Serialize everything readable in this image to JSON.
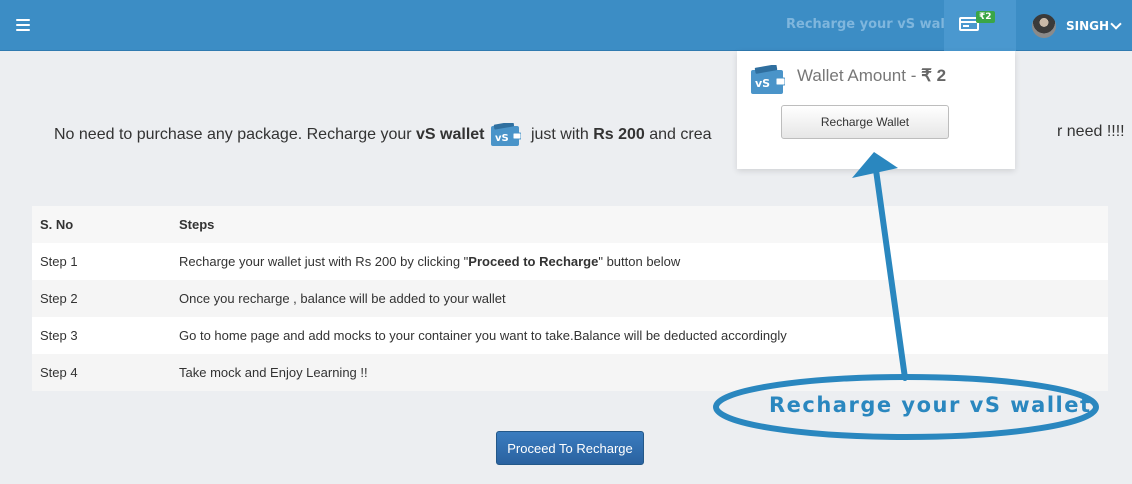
{
  "header": {
    "recharge_link": "Recharge your vS wallet",
    "wallet_badge": "₹2",
    "user_name": "SINGH"
  },
  "main": {
    "headline_prefix": "No need to purchase any package. Recharge your ",
    "headline_wallet": "vS wallet",
    "headline_middle": " just with ",
    "headline_amount": "Rs 200",
    "headline_suffix": " and crea",
    "headline_tail": "r need !!!!",
    "table": {
      "headers": [
        "S. No",
        "Steps"
      ],
      "rows": [
        {
          "num": "Step 1",
          "text_before": "Recharge your wallet just with Rs 200 by clicking \"",
          "text_bold": "Proceed to Recharge",
          "text_after": "\" button below"
        },
        {
          "num": "Step 2",
          "text": "Once you recharge , balance will be added to your wallet"
        },
        {
          "num": "Step 3",
          "text": "Go to home page and add mocks to your container you want to take.Balance will be deducted accordingly"
        },
        {
          "num": "Step 4",
          "text": "Take mock and Enjoy Learning !!"
        }
      ]
    },
    "proceed_button": "Proceed To Recharge"
  },
  "dropdown": {
    "title_prefix": "Wallet Amount - ",
    "amount": "₹ 2",
    "button": "Recharge Wallet"
  },
  "annotation": {
    "text": "Recharge your vS wallet"
  },
  "colors": {
    "header": "#3c8dc5",
    "accent": "#2a87bf",
    "badge": "#3aa647",
    "primary_button": "#2a62a0"
  },
  "icons": [
    "menu-icon",
    "card-icon",
    "vs-wallet-icon",
    "chevron-down-icon",
    "avatar"
  ]
}
